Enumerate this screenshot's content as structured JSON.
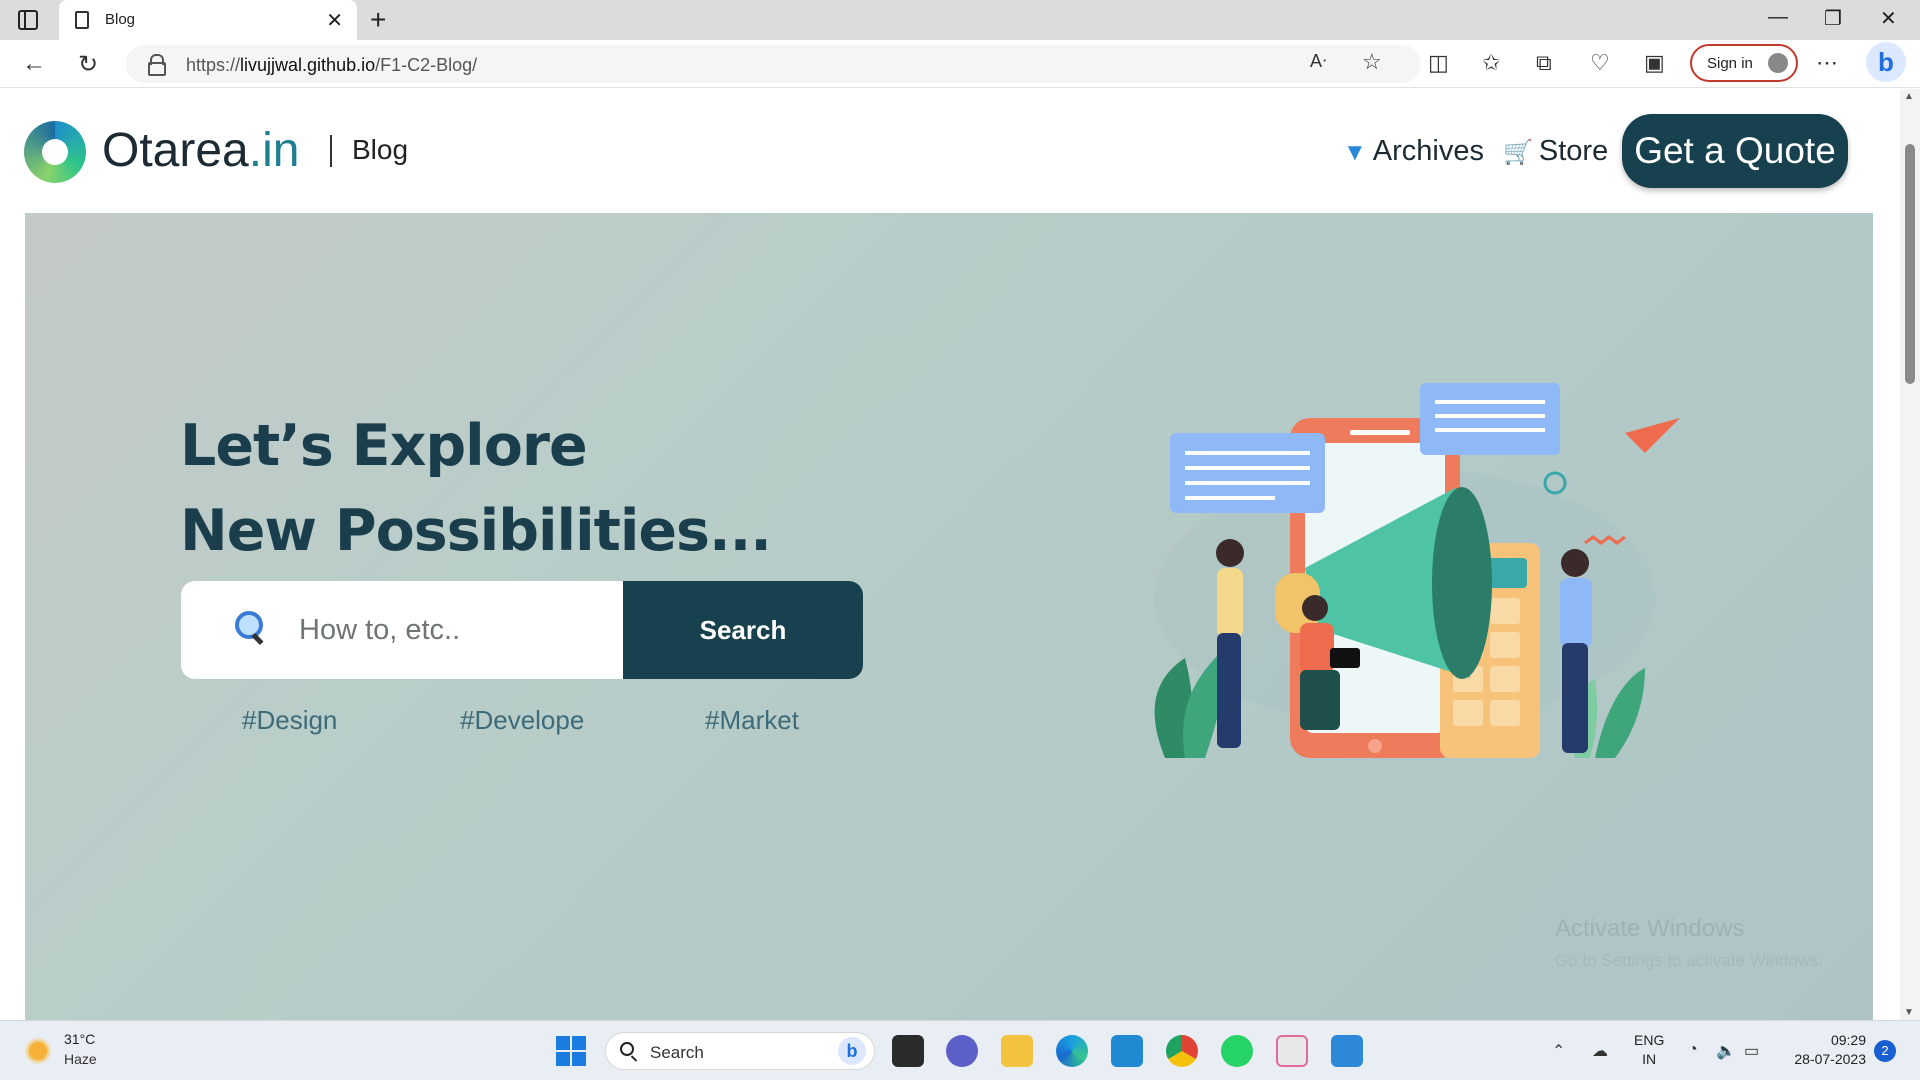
{
  "browser": {
    "tab_title": "Blog",
    "url_prefix": "https://",
    "url_host": "livujjwal.github.io",
    "url_path": "/F1-C2-Blog/",
    "signin_label": "Sign in"
  },
  "site": {
    "logo_name": "Otarea",
    "logo_tld": ".in",
    "section": "Blog",
    "nav": [
      {
        "label": "Archives",
        "icon": "down-triangle-icon"
      },
      {
        "label": "Store",
        "icon": "cart-icon"
      }
    ],
    "cta_label": "Get a Quote"
  },
  "hero": {
    "title_line1": "Let’s Explore",
    "title_line2": "New Possibilities...",
    "search_placeholder": "How to, etc..",
    "search_button": "Search",
    "tags": [
      "#Design",
      "#Develope",
      "#Market"
    ]
  },
  "watermark": {
    "line1": "Activate Windows",
    "line2": "Go to Settings to activate Windows."
  },
  "taskbar": {
    "weather_temp": "31°C",
    "weather_desc": "Haze",
    "search_label": "Search",
    "lang_line1": "ENG",
    "lang_line2": "IN",
    "time": "09:29",
    "date": "28-07-2023",
    "notification_count": "2"
  },
  "colors": {
    "brand_dark": "#17414f",
    "hero_bg": "#b4cac7",
    "accent_teal": "#1d7f8f"
  }
}
